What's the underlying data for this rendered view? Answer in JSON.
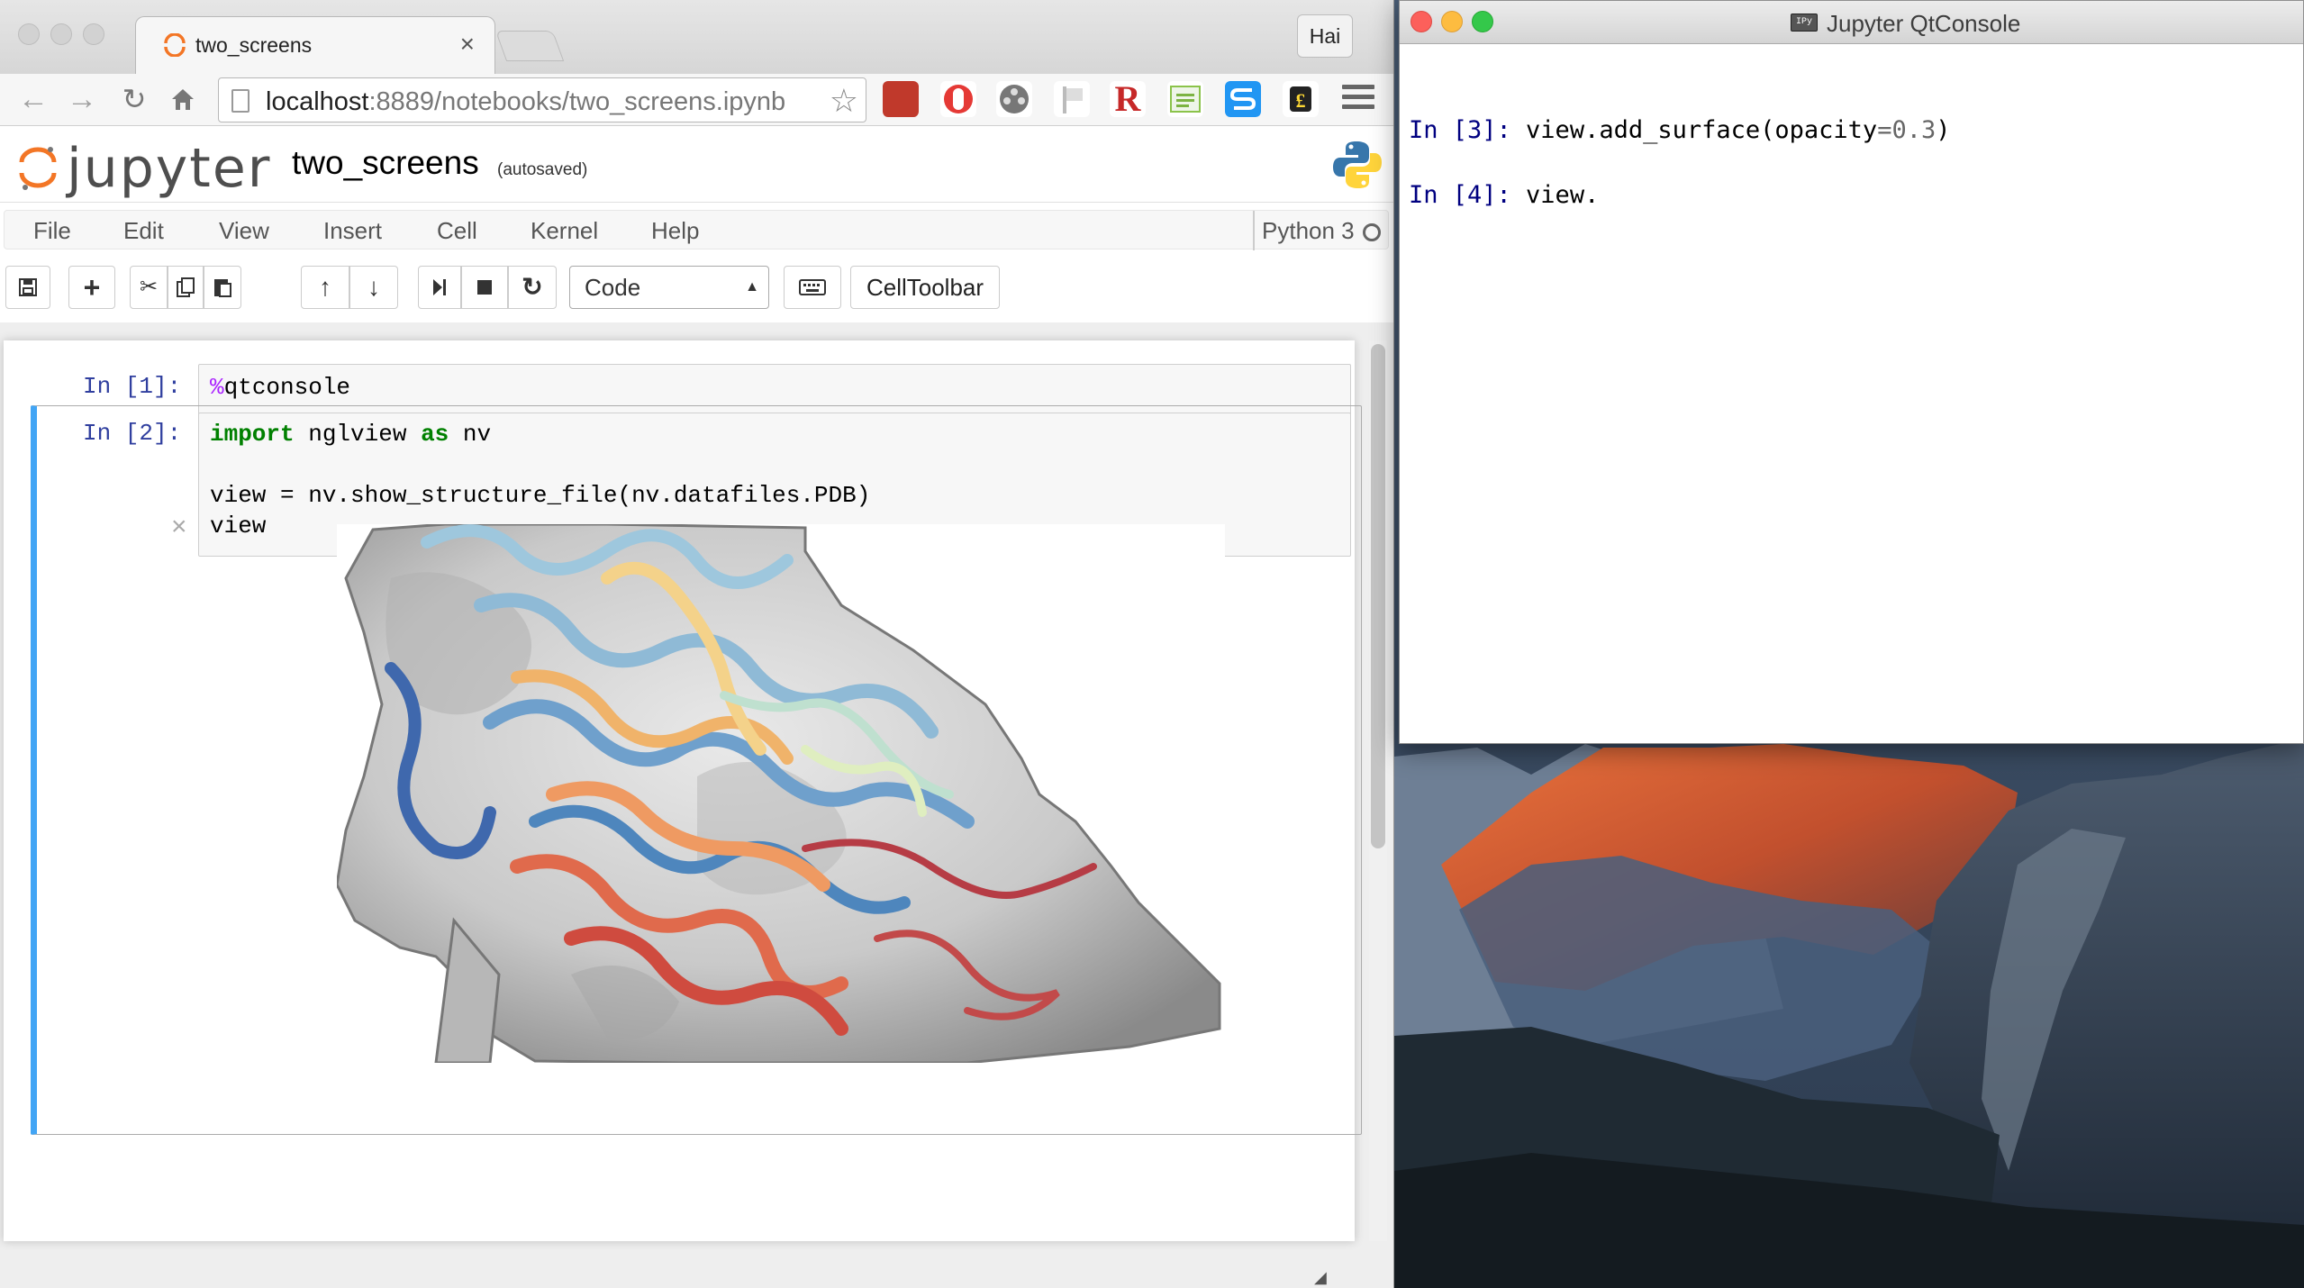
{
  "chrome": {
    "tab_title": "two_screens",
    "tab_close": "×",
    "profile_label": "Hai",
    "url_host": "localhost",
    "url_path": ":8889/notebooks/two_screens.ipynb",
    "extensions": [
      "bookmark-icon",
      "opera-icon",
      "film-icon",
      "flag-icon",
      "r-icon",
      "feed-icon",
      "s-icon",
      "evernote-icon"
    ]
  },
  "jupyter": {
    "logo_text": "jupyter",
    "notebook_name": "two_screens",
    "autosave_status": "(autosaved)",
    "menu": [
      "File",
      "Edit",
      "View",
      "Insert",
      "Cell",
      "Kernel",
      "Help"
    ],
    "kernel_name": "Python 3",
    "cell_type": "Code",
    "celltoolbar_label": "CellToolbar",
    "toolbar_icons": [
      "save-icon",
      "plus-icon",
      "cut-icon",
      "copy-icon",
      "paste-icon",
      "arrow-up-icon",
      "arrow-down-icon",
      "run-icon",
      "stop-icon",
      "restart-icon",
      "keyboard-icon"
    ],
    "cells": [
      {
        "prompt": "In [1]:",
        "magic": "%",
        "code_rest": "qtconsole"
      },
      {
        "prompt": "In [2]:",
        "kw_import": "import",
        "mod": " nglview ",
        "kw_as": "as",
        "alias": " nv",
        "line3": "view = nv.show_structure_file(nv.datafiles.PDB)",
        "line4": "view",
        "output_close": "×"
      }
    ]
  },
  "qtconsole": {
    "title": "Jupyter QtConsole",
    "icon_text": "IPy",
    "line1_prompt": "In [3]: ",
    "line1_code_a": "view.add_surface(opacity",
    "line1_eq": "=",
    "line1_num": "0.3",
    "line1_code_b": ")",
    "line2_prompt": "In [4]: ",
    "line2_code": "view."
  },
  "colors": {
    "cell_selected": "#42a5f5",
    "prompt_blue": "#303f9f",
    "jupyter_orange": "#f37626",
    "magic_purple": "#aa22ff",
    "keyword_green": "#008000"
  }
}
